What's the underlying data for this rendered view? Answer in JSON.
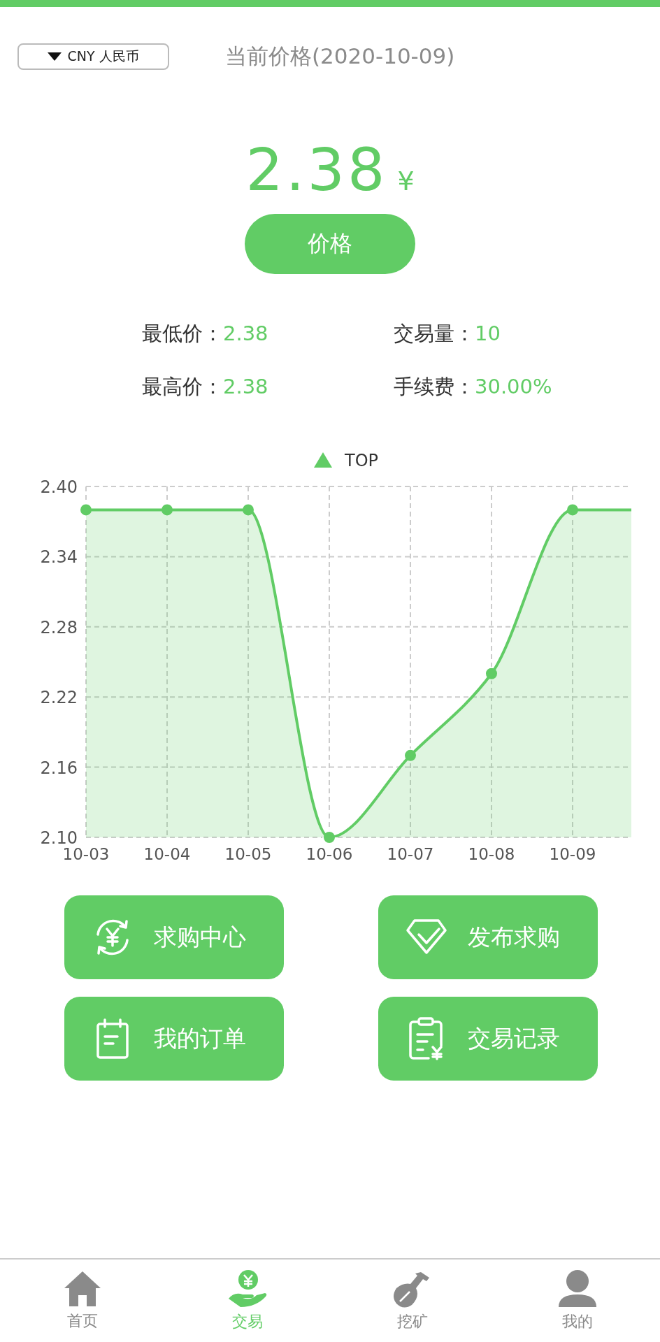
{
  "currency_select": {
    "value": "CNY 人民币"
  },
  "title": "当前价格(2020-10-09)",
  "price": {
    "value": "2.38",
    "unit": "¥"
  },
  "price_button": "价格",
  "stats": [
    {
      "label": "最低价：",
      "value": "2.38"
    },
    {
      "label": "交易量：",
      "value": "10"
    },
    {
      "label": "最高价：",
      "value": "2.38"
    },
    {
      "label": "手续费：",
      "value": "30.00%"
    }
  ],
  "chart_data": {
    "type": "area",
    "categories": [
      "10-03",
      "10-04",
      "10-05",
      "10-06",
      "10-07",
      "10-08",
      "10-09"
    ],
    "ylim": [
      2.1,
      2.4
    ],
    "yticks": [
      {
        "value": 2.1,
        "label": "2.10"
      },
      {
        "value": 2.16,
        "label": "2.16"
      },
      {
        "value": 2.22,
        "label": "2.22"
      },
      {
        "value": 2.28,
        "label": "2.28"
      },
      {
        "value": 2.34,
        "label": "2.34"
      },
      {
        "value": 2.4,
        "label": "2.40"
      }
    ],
    "grid": true,
    "series": [
      {
        "name": "TOP",
        "color": "#61cc65",
        "values": [
          2.38,
          2.38,
          2.38,
          2.1,
          2.17,
          2.24,
          2.38
        ]
      }
    ]
  },
  "actions": [
    {
      "kind": "exchange",
      "label": "求购中心"
    },
    {
      "kind": "diamond",
      "label": "发布求购"
    },
    {
      "kind": "calendar",
      "label": "我的订单"
    },
    {
      "kind": "clipboard",
      "label": "交易记录"
    }
  ],
  "nav": [
    {
      "kind": "home",
      "label": "首页",
      "selected": false
    },
    {
      "kind": "trade",
      "label": "交易",
      "selected": true
    },
    {
      "kind": "mining",
      "label": "挖矿",
      "selected": false
    },
    {
      "kind": "profile",
      "label": "我的",
      "selected": false
    }
  ]
}
